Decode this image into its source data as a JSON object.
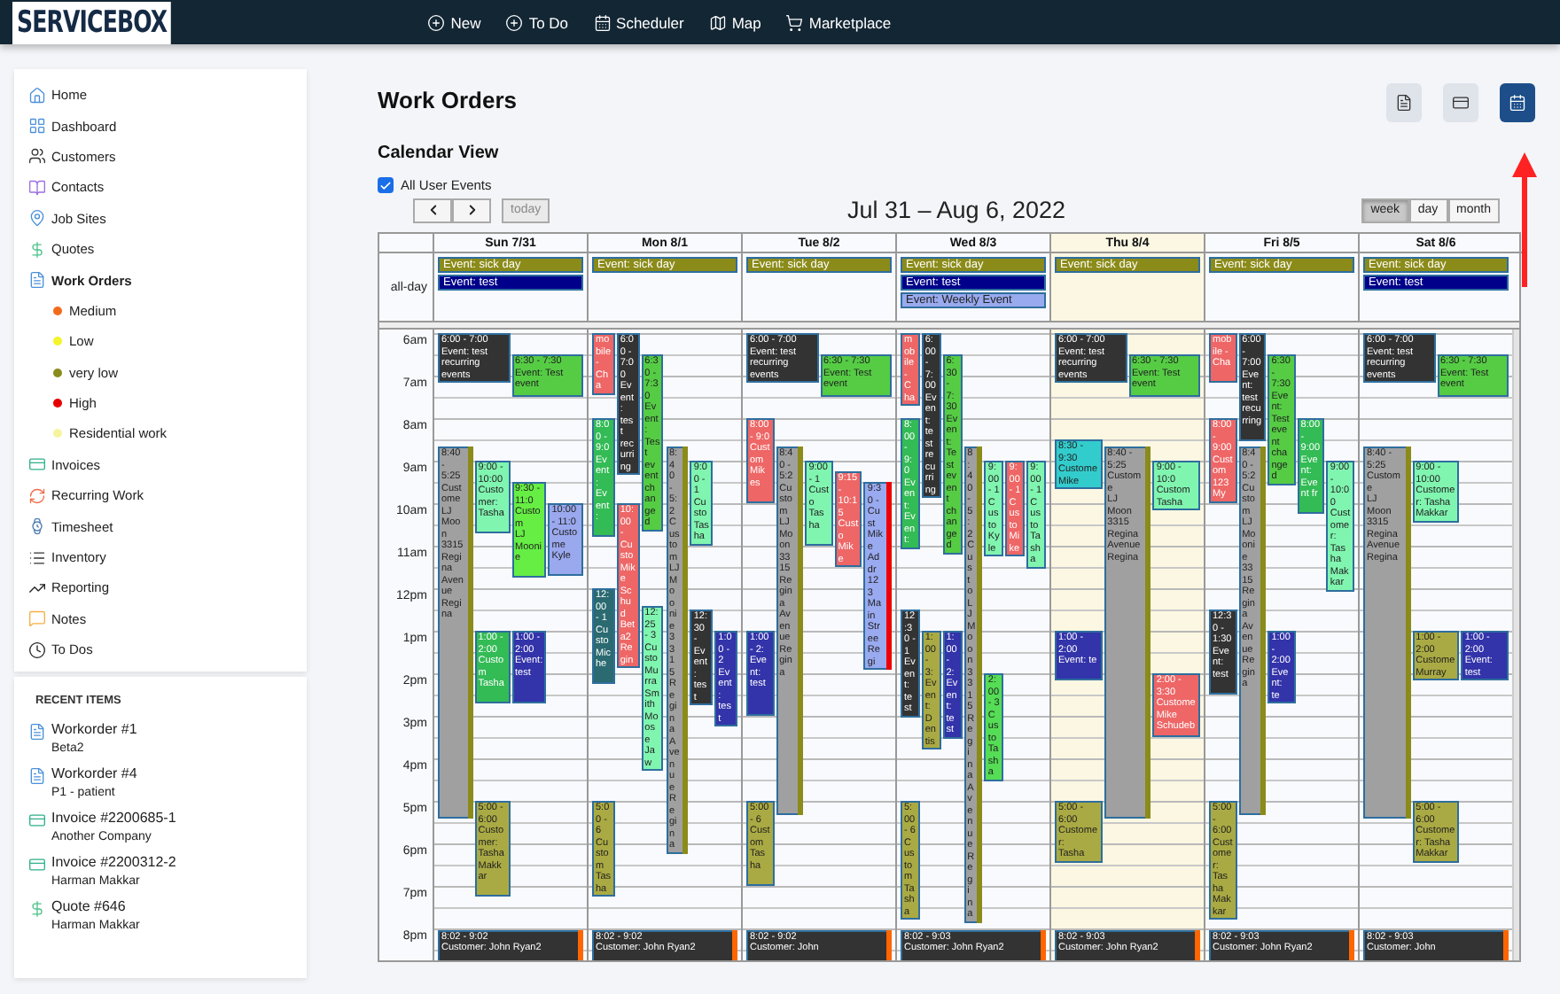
{
  "app": {
    "logo": "SERVICEBOX",
    "nav": [
      {
        "label": "New"
      },
      {
        "label": "To Do"
      },
      {
        "label": "Scheduler"
      },
      {
        "label": "Map"
      },
      {
        "label": "Marketplace"
      }
    ]
  },
  "sidebar": {
    "items": [
      {
        "label": "Home",
        "selected": false
      },
      {
        "label": "Dashboard",
        "selected": false
      },
      {
        "label": "Customers",
        "selected": false
      },
      {
        "label": "Contacts",
        "selected": false
      },
      {
        "label": "Job Sites",
        "selected": false
      },
      {
        "label": "Quotes",
        "selected": false
      },
      {
        "label": "Work Orders",
        "selected": true,
        "children": [
          {
            "label": "Medium",
            "color": "#f26b1d"
          },
          {
            "label": "Low",
            "color": "#f4f42a"
          },
          {
            "label": "very low",
            "color": "#8b8b1a"
          },
          {
            "label": "High",
            "color": "#e60000"
          },
          {
            "label": "Residential work",
            "color": "#f7f4a0"
          }
        ]
      },
      {
        "label": "Invoices",
        "selected": false
      },
      {
        "label": "Recurring Work",
        "selected": false
      },
      {
        "label": "Timesheet",
        "selected": false
      },
      {
        "label": "Inventory",
        "selected": false
      },
      {
        "label": "Reporting",
        "selected": false
      },
      {
        "label": "Notes",
        "selected": false
      },
      {
        "label": "To Dos",
        "selected": false
      }
    ]
  },
  "recent": {
    "title": "RECENT ITEMS",
    "items": [
      {
        "kind": "workorder",
        "title": "Workorder #1",
        "subtitle": "Beta2"
      },
      {
        "kind": "workorder",
        "title": "Workorder #4",
        "subtitle": "P1 - patient"
      },
      {
        "kind": "invoice",
        "title": "Invoice #2200685-1",
        "subtitle": "Another Company"
      },
      {
        "kind": "invoice",
        "title": "Invoice #2200312-2",
        "subtitle": "Harman Makkar"
      },
      {
        "kind": "quote",
        "title": "Quote #646",
        "subtitle": "Harman Makkar"
      }
    ]
  },
  "page": {
    "title": "Work Orders",
    "view_buttons": [
      {
        "kind": "list",
        "selected": false
      },
      {
        "kind": "card",
        "selected": false
      },
      {
        "kind": "calendar",
        "selected": true
      }
    ]
  },
  "calendar": {
    "title": "Calendar View",
    "filter": {
      "label": "All User Events",
      "checked": true
    },
    "today_button": {
      "label": "today",
      "disabled": true
    },
    "range": "Jul 31 – Aug 6, 2022",
    "views": [
      {
        "label": "week",
        "selected": true
      },
      {
        "label": "day",
        "selected": false
      },
      {
        "label": "month",
        "selected": false
      }
    ],
    "all_day_label": "all-day",
    "hours": [
      "6am",
      "7am",
      "8am",
      "9am",
      "10am",
      "11am",
      "12pm",
      "1pm",
      "2pm",
      "3pm",
      "4pm",
      "5pm",
      "6pm",
      "7pm",
      "8pm"
    ],
    "days": [
      {
        "label": "Sun 7/31",
        "today": false,
        "all_day": [
          {
            "label": "Event: sick day",
            "color": "#8b8b1a"
          },
          {
            "label": "Event: test",
            "color": "#00008b"
          }
        ],
        "events": [
          {
            "color": "#333333",
            "time": "6:00 - 7:00",
            "lines": [
              "Event: test recurring",
              "events"
            ]
          },
          {
            "color": "#55cc44",
            "time": "6:30 - 7:30",
            "lines": [
              "Event: Test",
              "event"
            ]
          },
          {
            "color": "#a0a0a0",
            "flag": {
              "color": "#8b8b1a"
            },
            "time": "8:40 - 5:25",
            "lines": [
              "Custome",
              "LJ Moon",
              "3315",
              "Regina",
              "Avenue",
              "Regina"
            ]
          },
          {
            "color": "#80f5b0",
            "time": "9:00 - 10:00",
            "lines": [
              "Customer:",
              "Tasha"
            ]
          },
          {
            "color": "#66ee44",
            "time": "9:30 - 11:0",
            "lines": [
              "Custom",
              "LJ",
              "Moonie"
            ]
          },
          {
            "color": "#9aa8ee",
            "time": "10:00 - 11:0",
            "lines": [
              "Custome",
              "Kyle"
            ]
          },
          {
            "color": "#33bb55",
            "time": "1:00 - 2:00",
            "lines": [
              "Custom",
              "Tasha"
            ]
          },
          {
            "color": "#3333aa",
            "time": "1:00 - 2:00",
            "lines": [
              "Event:",
              "test"
            ]
          },
          {
            "color": "#aaaa44",
            "time": "5:00 - 6:00",
            "lines": [
              "Customer:",
              "Tasha Makkar"
            ]
          },
          {
            "color": "#333333",
            "flag": {
              "color": "#ff6600"
            },
            "time": "8:02 - 9:02",
            "lines": [
              "Customer: John Ryan2"
            ]
          }
        ]
      },
      {
        "label": "Mon 8/1",
        "today": false,
        "all_day": [
          {
            "label": "Event: sick day",
            "color": "#8b8b1a"
          }
        ],
        "events": [
          {
            "color": "#ee6666",
            "lines": [
              "mobile - Cha"
            ]
          },
          {
            "color": "#55cc44",
            "time": "6:30 - 7:30",
            "lines": [
              "Event: Test event",
              "changed"
            ]
          },
          {
            "color": "#333333",
            "time": "6:00 - 7:00",
            "lines": [
              "Event: test",
              "recurring"
            ]
          },
          {
            "color": "#33bb55",
            "time": "8:00 - 9:0",
            "lines": [
              "Event:",
              "Event:"
            ]
          },
          {
            "color": "#a0a0a0",
            "flag": {
              "color": "#8b8b1a"
            },
            "time": "8:40 - 5:2",
            "lines": [
              "Custom",
              "LJ",
              "Moonie",
              "3315",
              "Regina",
              "Avenue",
              "Regina"
            ]
          },
          {
            "color": "#80f5b0",
            "time": "9:00 - 1",
            "lines": [
              "Custo",
              "Tasha"
            ]
          },
          {
            "color": "#2a6a70",
            "time": "12:00 - 1",
            "lines": [
              "Custo",
              "Miche"
            ]
          },
          {
            "color": "#ee6666",
            "time": "10:00 -",
            "lines": [
              "Custo",
              "Mike",
              "Schud",
              "Beta2",
              "Regin"
            ]
          },
          {
            "color": "#80f5b0",
            "time": "12:25 - 3",
            "lines": [
              "Custo",
              "Murra",
              "Smith",
              "Moose",
              "Jaw"
            ]
          },
          {
            "color": "#333333",
            "time": "12:30 -",
            "lines": [
              "Event:",
              "test"
            ]
          },
          {
            "color": "#3333aa",
            "time": "1:00 - 2",
            "lines": [
              "Event:",
              "test"
            ]
          },
          {
            "color": "#aaaa44",
            "time": "5:00 - 6",
            "lines": [
              "Custom",
              "Tasha"
            ]
          },
          {
            "color": "#333333",
            "flag": {
              "color": "#ff6600"
            },
            "time": "8:02 - 9:02",
            "lines": [
              "Customer: John Ryan2"
            ]
          }
        ]
      },
      {
        "label": "Tue 8/2",
        "today": false,
        "all_day": [
          {
            "label": "Event: sick day",
            "color": "#8b8b1a"
          }
        ],
        "events": [
          {
            "color": "#333333",
            "time": "6:00 - 7:00",
            "lines": [
              "Event: test recurring",
              "events"
            ]
          },
          {
            "color": "#55cc44",
            "time": "6:30 - 7:30",
            "lines": [
              "Event: Test",
              "event"
            ]
          },
          {
            "color": "#ee6666",
            "time": "8:00 - 9:0",
            "lines": [
              "Custom",
              "Mikes"
            ]
          },
          {
            "color": "#a0a0a0",
            "flag": {
              "color": "#8b8b1a"
            },
            "time": "8:40 - 5:2",
            "lines": [
              "Custom",
              "LJ",
              "Moon",
              "3315",
              "Regina",
              "Avenue",
              "Regina"
            ]
          },
          {
            "color": "#80f5b0",
            "time": "9:00 - 1",
            "lines": [
              "Custo",
              "Tasha"
            ]
          },
          {
            "color": "#ee6666",
            "time": "9:15 - 10:15",
            "lines": [
              "Custo",
              "Mike"
            ]
          },
          {
            "color": "#9aaaf0",
            "flag": {
              "color": "#ee0000"
            },
            "time": "9:30 -",
            "lines": [
              "Cust",
              "Mike",
              "Addr",
              "123",
              "Main",
              "Stree",
              "Regi"
            ]
          },
          {
            "color": "#3333aa",
            "time": "1:00 - 2:",
            "lines": [
              "Event:",
              "test"
            ]
          },
          {
            "color": "#aaaa44",
            "time": "5:00 - 6",
            "lines": [
              "Custom",
              "Tasha"
            ]
          },
          {
            "color": "#333333",
            "flag": {
              "color": "#ff6600"
            },
            "time": "8:02 - 9:02",
            "lines": [
              "Customer: John"
            ]
          }
        ]
      },
      {
        "label": "Wed 8/3",
        "today": false,
        "all_day": [
          {
            "label": "Event: sick day",
            "color": "#8b8b1a"
          },
          {
            "label": "Event: test",
            "color": "#00008b"
          },
          {
            "label": "Event: Weekly Event",
            "color": "#99aaee"
          }
        ],
        "events": [
          {
            "color": "#ee6666",
            "lines": [
              "mobile - Cha"
            ]
          },
          {
            "color": "#55cc44",
            "time": "6:30 - 7:30",
            "lines": [
              "Event: Test event",
              "changed"
            ]
          },
          {
            "color": "#333333",
            "time": "6:00 - 7:00",
            "lines": [
              "Event: test",
              "recurring"
            ]
          },
          {
            "color": "#33bb55",
            "time": "8:00 - 9:0",
            "lines": [
              "Event:",
              "Event:"
            ]
          },
          {
            "color": "#a0a0a0",
            "flag": {
              "color": "#8b8b1a"
            },
            "time": "8:40 - 5:2",
            "lines": [
              "Custo",
              "LJ",
              "Moon",
              "3315",
              "Regina",
              "Avenue",
              "Regina"
            ]
          },
          {
            "color": "#80f5b0",
            "time": "9:00 - 1",
            "lines": [
              "Custo",
              "Kyle"
            ]
          },
          {
            "color": "#ee6666",
            "time": "9:00 - 1",
            "lines": [
              "Custo",
              "Mike"
            ]
          },
          {
            "color": "#80f5b0",
            "time": "9:00 - 1",
            "lines": [
              "Custo",
              "Tasha"
            ]
          },
          {
            "color": "#333333",
            "time": "12:30 - 1",
            "lines": [
              "Event:",
              "test"
            ]
          },
          {
            "color": "#aaaa44",
            "time": "1:00 - 3:",
            "lines": [
              "Event:",
              "Dentis"
            ]
          },
          {
            "color": "#3333aa",
            "time": "1:00 - 2:",
            "lines": [
              "Event:",
              "test"
            ]
          },
          {
            "color": "#55dd55",
            "time": "2:00 - 3",
            "lines": [
              "Custo",
              "Tasha"
            ]
          },
          {
            "color": "#aaaa44",
            "time": "5:00 - 6",
            "lines": [
              "Custom",
              "Tasha"
            ]
          },
          {
            "color": "#333333",
            "flag": {
              "color": "#ff6600"
            },
            "time": "8:02 - 9:03",
            "lines": [
              "Customer: John Ryan2"
            ]
          }
        ]
      },
      {
        "label": "Thu 8/4",
        "today": true,
        "all_day": [
          {
            "label": "Event: sick day",
            "color": "#8b8b1a"
          }
        ],
        "events": [
          {
            "color": "#333333",
            "time": "6:00 - 7:00",
            "lines": [
              "Event: test recurring",
              "events"
            ]
          },
          {
            "color": "#55cc44",
            "time": "6:30 - 7:30",
            "lines": [
              "Event: Test",
              "event"
            ]
          },
          {
            "color": "#33cccc",
            "time": "8:30 - 9:30",
            "lines": [
              "Custome",
              "Mike"
            ]
          },
          {
            "color": "#a0a0a0",
            "flag": {
              "color": "#8b8b1a"
            },
            "time": "8:40 - 5:25",
            "lines": [
              "Custome",
              "LJ Moon",
              "3315",
              "Regina",
              "Avenue",
              "Regina"
            ]
          },
          {
            "color": "#80f5b0",
            "time": "9:00 - 10:0",
            "lines": [
              "Custom",
              "Tasha"
            ]
          },
          {
            "color": "#3333aa",
            "time": "1:00 - 2:00",
            "lines": [
              "Event: te"
            ]
          },
          {
            "color": "#ee6666",
            "time": "2:00 - 3:30",
            "lines": [
              "Custome",
              "Mike",
              "Schudeb"
            ]
          },
          {
            "color": "#aaaa44",
            "time": "5:00 - 6:00",
            "lines": [
              "Customer:",
              "Tasha"
            ]
          },
          {
            "color": "#333333",
            "flag": {
              "color": "#ff6600"
            },
            "time": "8:02 - 9:03",
            "lines": [
              "Customer: John Ryan2"
            ]
          }
        ]
      },
      {
        "label": "Fri 8/5",
        "today": false,
        "all_day": [
          {
            "label": "Event: sick day",
            "color": "#8b8b1a"
          }
        ],
        "events": [
          {
            "color": "#ee6666",
            "lines": [
              "mobile - Cha"
            ]
          },
          {
            "color": "#55cc44",
            "time": "6:30 - 7:30",
            "lines": [
              "Event: Test event",
              "changed"
            ]
          },
          {
            "color": "#333333",
            "time": "6:00 - 7:00",
            "lines": [
              "Event: test",
              "recurring"
            ]
          },
          {
            "color": "#ee6666",
            "time": "8:00 - 9:00",
            "lines": [
              "Custom",
              "123 My"
            ]
          },
          {
            "color": "#33bb55",
            "time": "8:00 - 9:00",
            "lines": [
              "Event:",
              "Event fr"
            ]
          },
          {
            "color": "#a0a0a0",
            "flag": {
              "color": "#8b8b1a"
            },
            "time": "8:40 - 5:2",
            "lines": [
              "Custom",
              "LJ",
              "Moonie",
              "3315",
              "Regina",
              "Avenue",
              "Regina"
            ]
          },
          {
            "color": "#80f5b0",
            "time": "9:00 - 10:00",
            "lines": [
              "Customer: Tasha",
              "Makkar"
            ]
          },
          {
            "color": "#333333",
            "time": "12:30 - 1:30",
            "lines": [
              "Event: test"
            ]
          },
          {
            "color": "#3333aa",
            "time": "1:00 - 2:00",
            "lines": [
              "Event: te"
            ]
          },
          {
            "color": "#aaaa44",
            "time": "5:00 - 6:00",
            "lines": [
              "Customer: Tasha",
              "Makkar"
            ]
          },
          {
            "color": "#333333",
            "flag": {
              "color": "#ff6600"
            },
            "time": "8:02 - 9:03",
            "lines": [
              "Customer: John Ryan2"
            ]
          }
        ]
      },
      {
        "label": "Sat 8/6",
        "today": false,
        "all_day": [
          {
            "label": "Event: sick day",
            "color": "#8b8b1a"
          },
          {
            "label": "Event: test",
            "color": "#00008b"
          }
        ],
        "events": [
          {
            "color": "#333333",
            "time": "6:00 - 7:00",
            "lines": [
              "Event: test recurring",
              "events"
            ]
          },
          {
            "color": "#55cc44",
            "time": "6:30 - 7:30",
            "lines": [
              "Event: Test",
              "event"
            ]
          },
          {
            "color": "#a0a0a0",
            "flag": {
              "color": "#8b8b1a"
            },
            "time": "8:40 - 5:25",
            "lines": [
              "Custome",
              "LJ Moon",
              "3315",
              "Regina",
              "Avenue",
              "Regina"
            ]
          },
          {
            "color": "#80f5b0",
            "time": "9:00 - 10:00",
            "lines": [
              "Customer: Tasha",
              "Makkar"
            ]
          },
          {
            "color": "#aaaa44",
            "time": "1:00 - 2:00",
            "lines": [
              "Custome",
              "Murray"
            ]
          },
          {
            "color": "#3333aa",
            "time": "1:00 - 2:00",
            "lines": [
              "Event:",
              "test"
            ]
          },
          {
            "color": "#aaaa44",
            "time": "5:00 - 6:00",
            "lines": [
              "Customer: Tasha",
              "Makkar"
            ]
          },
          {
            "color": "#333333",
            "flag": {
              "color": "#ff6600"
            },
            "time": "8:02 - 9:03",
            "lines": [
              "Customer: John"
            ]
          }
        ]
      }
    ]
  }
}
